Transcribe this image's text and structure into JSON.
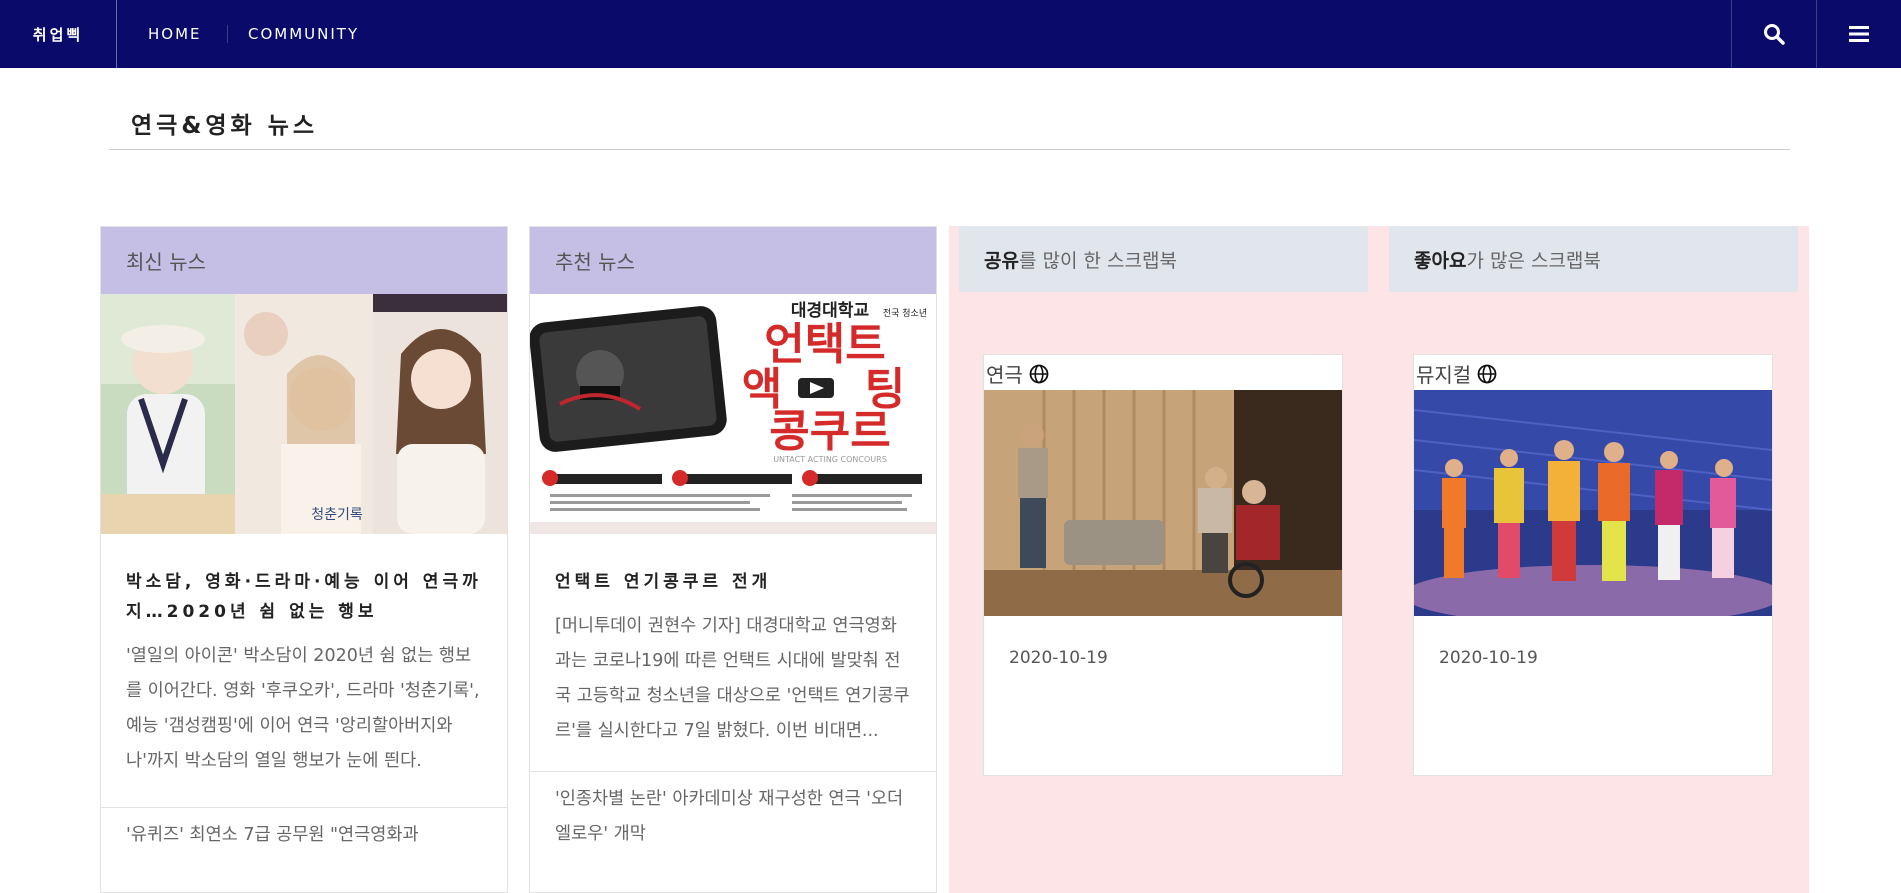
{
  "nav": {
    "brand": "취업삑",
    "links": [
      "HOME",
      "COMMUNITY"
    ],
    "colors": {
      "bar": "#0a0a6b"
    }
  },
  "page": {
    "title": "연극&영화 뉴스"
  },
  "latest": {
    "header": "최신 뉴스",
    "article_title": "박소담, 영화·드라마·예능 이어 연극까지…2020년 쉼 없는 행보",
    "article_body": "'열일의 아이콘' 박소담이 2020년 쉼 없는 행보를 이어간다. 영화 '후쿠오카', 드라마 '청춘기록', 예능 '갬성캠핑'에 이어 연극 '앙리할아버지와 나'까지 박소담의 열일 행보가 눈에 띈다.",
    "next_article": "'유퀴즈' 최연소 7급 공무원 \"연극영화과",
    "image_text": "청춘기록"
  },
  "recommended": {
    "header": "추천 뉴스",
    "article_title": "언택트 연기콩쿠르 전개",
    "article_body": "[머니투데이 권현수 기자] 대경대학교 연극영화과는 코로나19에 따른 언택트 시대에 발맞춰 전국 고등학교 청소년을 대상으로 '언택트 연기콩쿠르'를 실시한다고 7일 밝혔다. 이번 비대면...",
    "next_article": "'인종차별 논란' 아카데미상 재구성한 연극 '오더엘로우' 개막",
    "poster": {
      "school": "대경대학교",
      "school_sub": "전국 청소년",
      "line1": "언택트",
      "line2a": "액",
      "line2b": "팅",
      "line3": "콩쿠르",
      "english": "UNTACT ACTING CONCOURS"
    }
  },
  "shared": {
    "header_bold": "공유",
    "header_rest": "를 많이 한 스크랩북",
    "card": {
      "category": "연극",
      "date": "2020-10-19"
    }
  },
  "liked": {
    "header_bold": "좋아요",
    "header_rest": "가 많은 스크랩북",
    "card": {
      "category": "뮤지컬",
      "date": "2020-10-19"
    }
  }
}
